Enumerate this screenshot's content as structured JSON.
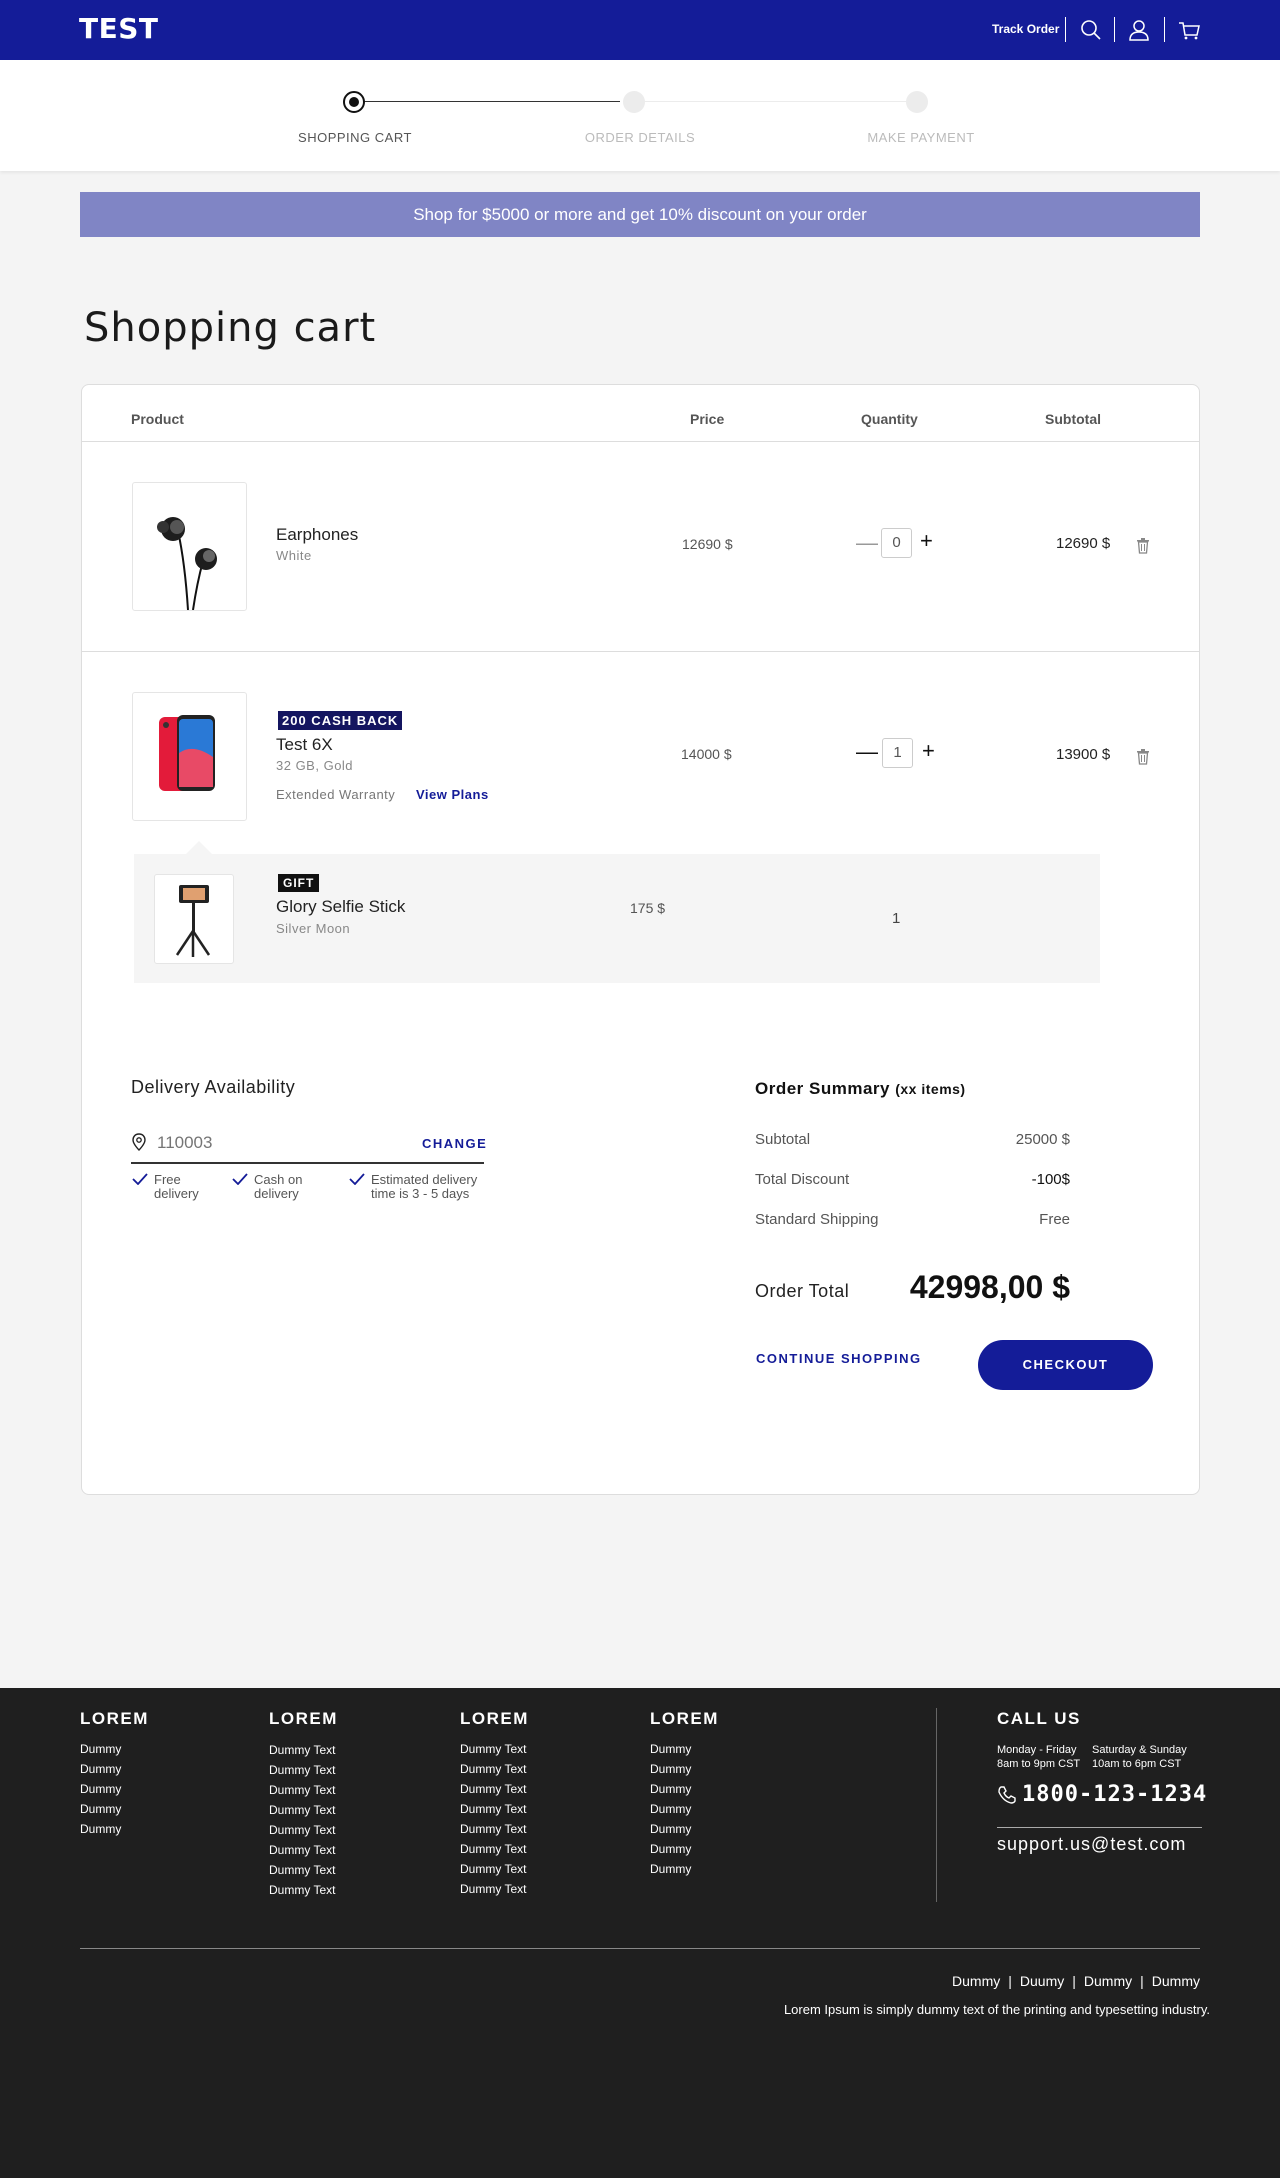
{
  "header": {
    "logo": "TEST",
    "track_order": "Track Order",
    "icons": [
      "search-icon",
      "user-icon",
      "cart-icon"
    ]
  },
  "stepper": {
    "steps": [
      {
        "label": "SHOPPING CART",
        "active": true
      },
      {
        "label": "ORDER DETAILS",
        "active": false
      },
      {
        "label": "MAKE PAYMENT",
        "active": false
      }
    ]
  },
  "promo": "Shop for $5000 or more and get 10% discount on your order",
  "page_title": "Shopping cart",
  "table": {
    "headers": {
      "product": "Product",
      "price": "Price",
      "quantity": "Quantity",
      "subtotal": "Subtotal"
    }
  },
  "items": [
    {
      "name": "Earphones",
      "variant": "White",
      "price": "12690 $",
      "qty": "0",
      "subtotal": "12690 $"
    },
    {
      "badge": "200 CASH BACK",
      "name": "Test 6X",
      "variant": "32 GB, Gold",
      "price": "14000 $",
      "qty": "1",
      "subtotal": "13900 $",
      "warranty": "Extended Warranty",
      "view_plans": "View Plans"
    }
  ],
  "gift": {
    "badge": "GIFT",
    "name": "Glory Selfie Stick",
    "variant": "Silver Moon",
    "price": "175 $",
    "qty": "1"
  },
  "delivery": {
    "title": "Delivery Availability",
    "pincode_placeholder": "110003",
    "change": "CHANGE",
    "features": [
      {
        "l1": "Free",
        "l2": "delivery"
      },
      {
        "l1": "Cash on",
        "l2": "delivery"
      },
      {
        "l1": "Estimated delivery",
        "l2": "time is 3 - 5 days"
      }
    ]
  },
  "summary": {
    "title": "Order Summary",
    "count": "(xx items)",
    "rows": [
      {
        "label": "Subtotal",
        "value": "25000 $"
      },
      {
        "label": "Total Discount",
        "value": "-100$"
      },
      {
        "label": "Standard Shipping",
        "value": "Free"
      }
    ],
    "total_label": "Order Total",
    "total_value": "42998,00 $",
    "continue": "CONTINUE SHOPPING",
    "checkout": "CHECKOUT"
  },
  "footer": {
    "columns": [
      {
        "title": "LOREM",
        "links": [
          "Dummy",
          "Dummy",
          "Dummy",
          "Dummy",
          "Dummy"
        ]
      },
      {
        "title": "LOREM",
        "links": [
          "Dummy Text",
          "Dummy Text",
          "Dummy Text",
          "Dummy Text",
          "Dummy Text",
          "Dummy Text",
          "Dummy Text",
          "Dummy Text"
        ]
      },
      {
        "title": "LOREM",
        "links": [
          "Dummy Text",
          "Dummy Text",
          "Dummy Text",
          "Dummy Text",
          "Dummy Text",
          "Dummy Text",
          "Dummy Text",
          "Dummy Text"
        ]
      },
      {
        "title": "LOREM",
        "links": [
          "Dummy",
          "Dummy",
          "Dummy",
          "Dummy",
          "Dummy",
          "Dummy",
          "Dummy"
        ]
      }
    ],
    "call": {
      "title": "CALL US",
      "weekday_l1": "Monday - Friday",
      "weekday_l2": "8am to 9pm CST",
      "weekend_l1": "Saturday & Sunday",
      "weekend_l2": "10am to 6pm CST",
      "phone": "1800-123-1234",
      "email": "support.us@test.com"
    },
    "bottom_links": [
      "Dummy",
      "Duumy",
      "Dummy",
      "Dummy"
    ],
    "legal": "Lorem Ipsum is simply dummy text of the printing and typesetting industry."
  }
}
